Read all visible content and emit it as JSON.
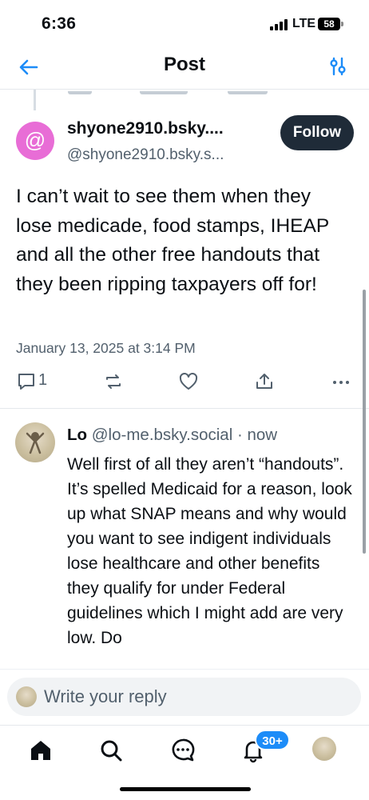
{
  "status_bar": {
    "time": "6:36",
    "network": "LTE",
    "battery": "58"
  },
  "header": {
    "title": "Post",
    "back_icon": "arrow-left-icon",
    "filter_icon": "sliders-icon"
  },
  "post": {
    "avatar_symbol": "@",
    "avatar_color": "#e86dd6",
    "display_name": "shyone2910.bsky....",
    "handle": "@shyone2910.bsky.s...",
    "follow_label": "Follow",
    "text": "I can’t wait to see them when they lose medicade, food stamps, IHEAP and all the other free handouts that they been ripping taxpayers off for!",
    "timestamp": "January 13, 2025 at 3:14 PM",
    "reply_count": "1"
  },
  "reply": {
    "display_name": "Lo",
    "handle": "@lo-me.bsky.social",
    "separator": "·",
    "time": "now",
    "text": "Well first of all they aren’t “handouts”.  It’s spelled Medicaid for a reason, look up what SNAP means and why would you want to see indigent individuals lose healthcare and other benefits they qualify for under Federal guidelines which I might add are very low. Do"
  },
  "composer": {
    "placeholder": "Write your reply"
  },
  "nav": {
    "items": [
      "home-icon",
      "search-icon",
      "chat-icon",
      "bell-icon",
      "profile-avatar"
    ],
    "notification_badge": "30+"
  },
  "colors": {
    "accent": "#1d8cf8",
    "follow_bg": "#1f2b38",
    "muted": "#52606d"
  }
}
